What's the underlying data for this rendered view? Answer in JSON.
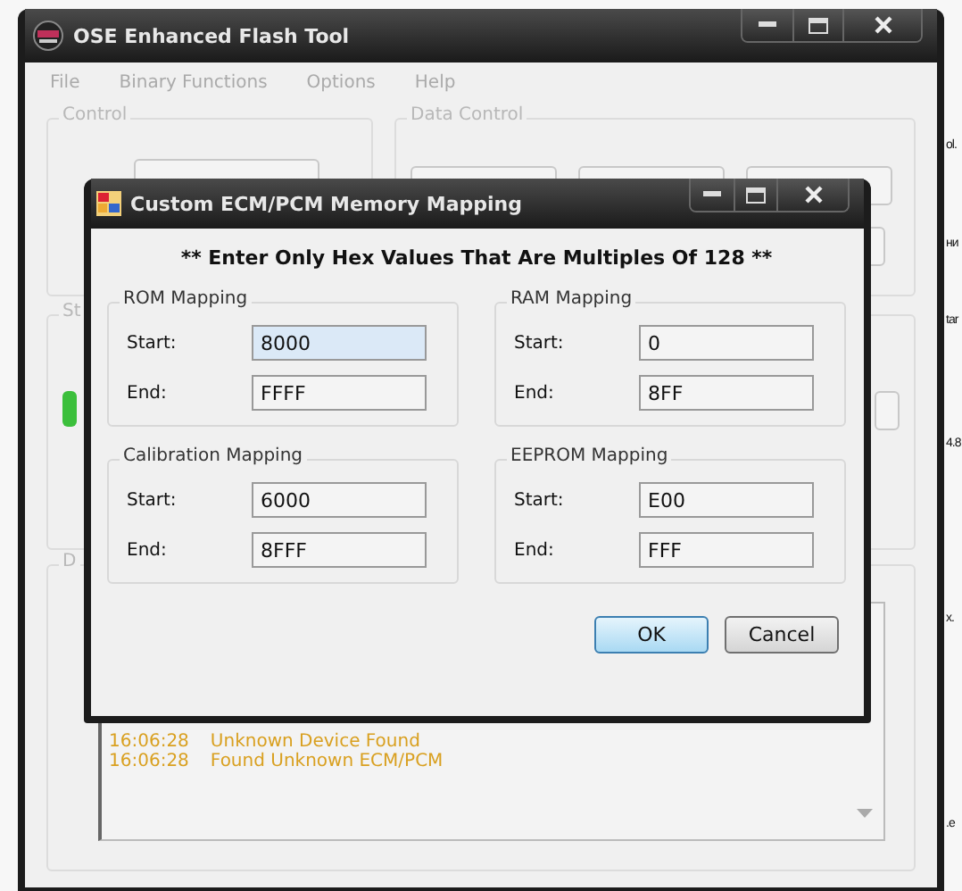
{
  "desktop": {
    "edge_texts": [
      "ol.",
      "ни",
      "tar",
      "4.8",
      "x.",
      ".e"
    ]
  },
  "main_window": {
    "title": "OSE Enhanced Flash Tool",
    "menu": [
      "File",
      "Binary Functions",
      "Options",
      "Help"
    ],
    "groups": [
      "Control",
      "Data Control",
      "St",
      "D"
    ],
    "log": [
      {
        "time": "16:06:28",
        "message": "Unknown Device Found"
      },
      {
        "time": "16:06:28",
        "message": "Found Unknown ECM/PCM"
      }
    ]
  },
  "dialog": {
    "title": "Custom ECM/PCM Memory Mapping",
    "instruction": "** Enter Only Hex Values That Are Multiples Of 128 **",
    "groups": [
      {
        "title": "ROM Mapping",
        "fields": [
          {
            "label": "Start:",
            "value": "8000",
            "focused": true
          },
          {
            "label": "End:",
            "value": "FFFF",
            "focused": false
          }
        ]
      },
      {
        "title": "RAM Mapping",
        "fields": [
          {
            "label": "Start:",
            "value": "0",
            "focused": false
          },
          {
            "label": "End:",
            "value": "8FF",
            "focused": false
          }
        ]
      },
      {
        "title": "Calibration Mapping",
        "fields": [
          {
            "label": "Start:",
            "value": "6000",
            "focused": false
          },
          {
            "label": "End:",
            "value": "8FFF",
            "focused": false
          }
        ]
      },
      {
        "title": "EEPROM Mapping",
        "fields": [
          {
            "label": "Start:",
            "value": "E00",
            "focused": false
          },
          {
            "label": "End:",
            "value": "FFF",
            "focused": false
          }
        ]
      }
    ],
    "buttons": [
      {
        "label": "OK",
        "default": true
      },
      {
        "label": "Cancel",
        "default": false
      }
    ]
  }
}
